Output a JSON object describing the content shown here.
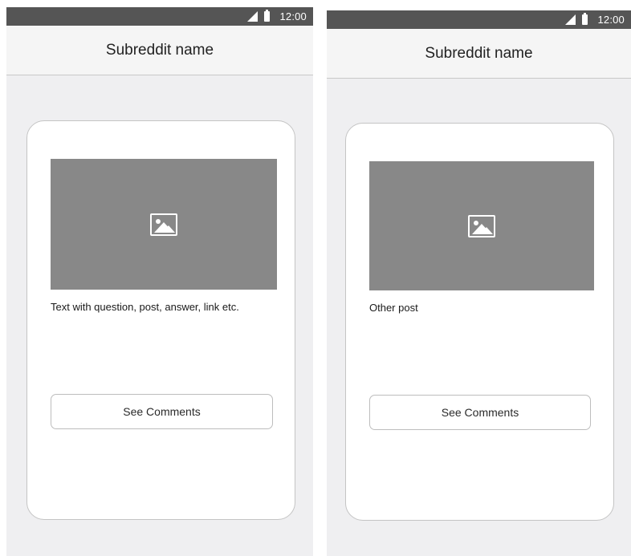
{
  "screens": [
    {
      "status_bar": {
        "time": "12:00",
        "signal_icon": "signal-icon",
        "battery_icon": "battery-icon"
      },
      "app_bar": {
        "title": "Subreddit name"
      },
      "post": {
        "image_icon": "image-icon",
        "text": "Text with question, post, answer, link etc.",
        "button_label": "See Comments"
      }
    },
    {
      "status_bar": {
        "time": "12:00",
        "signal_icon": "signal-icon",
        "battery_icon": "battery-icon"
      },
      "app_bar": {
        "title": "Subreddit name"
      },
      "post": {
        "image_icon": "image-icon",
        "text": "Other post",
        "button_label": "See Comments"
      }
    }
  ],
  "colors": {
    "status_bar": "#555555",
    "app_bar": "#f5f5f5",
    "screen_background": "#efeff1",
    "card": "#ffffff",
    "image_placeholder": "#888888"
  }
}
